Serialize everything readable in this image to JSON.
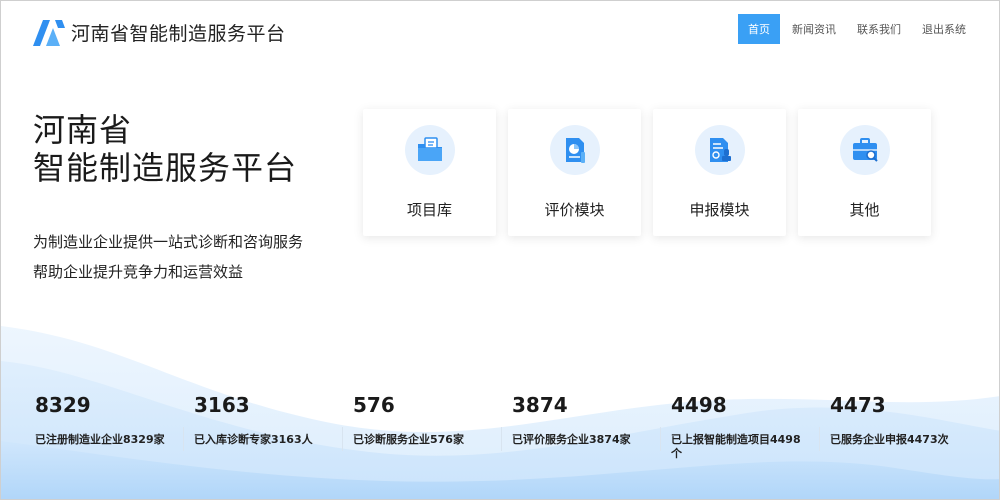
{
  "header": {
    "logo_text": "河南省智能制造服务平台",
    "nav": [
      {
        "label": "首页",
        "active": true
      },
      {
        "label": "新闻资讯",
        "active": false
      },
      {
        "label": "联系我们",
        "active": false
      },
      {
        "label": "退出系统",
        "active": false
      }
    ]
  },
  "hero": {
    "title_line1": "河南省",
    "title_line2": "智能制造服务平台",
    "sub_line1": "为制造业企业提供一站式诊断和咨询服务",
    "sub_line2": "帮助企业提升竞争力和运营效益"
  },
  "cards": [
    {
      "label": "项目库",
      "icon": "folder-icon"
    },
    {
      "label": "评价模块",
      "icon": "document-chart-icon"
    },
    {
      "label": "申报模块",
      "icon": "document-stamp-icon"
    },
    {
      "label": "其他",
      "icon": "briefcase-search-icon"
    }
  ],
  "stats": [
    {
      "value": "8329",
      "label": "已注册制造业企业8329家"
    },
    {
      "value": "3163",
      "label": "已入库诊断专家3163人"
    },
    {
      "value": "576",
      "label": "已诊断服务企业576家"
    },
    {
      "value": "3874",
      "label": "已评价服务企业3874家"
    },
    {
      "value": "4498",
      "label": "已上报智能制造项目4498个"
    },
    {
      "value": "4473",
      "label": "已服务企业申报4473次"
    }
  ],
  "colors": {
    "accent": "#3aa0f5",
    "icon_bg": "#e6f1fd",
    "icon_blue": "#2f8ff0"
  }
}
